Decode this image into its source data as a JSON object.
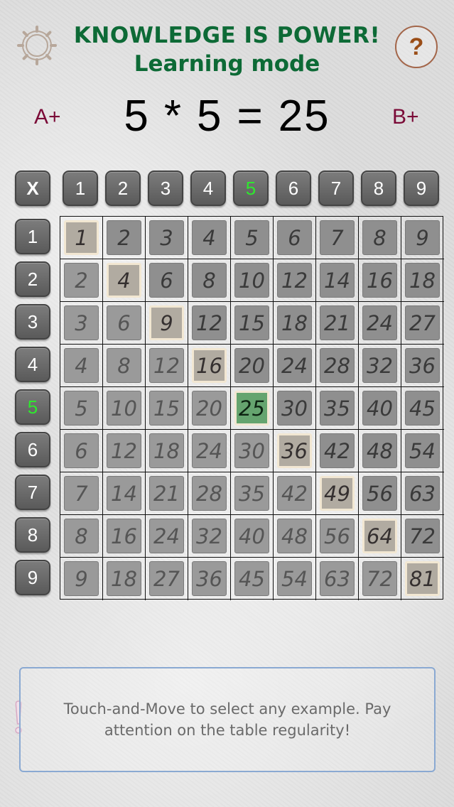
{
  "header": {
    "title": "KNOWLEDGE IS POWER!",
    "subtitle": "Learning mode",
    "settings_icon": "gear-icon",
    "help_label": "?"
  },
  "equation": {
    "a": "5",
    "op": "*",
    "b": "5",
    "eq": "=",
    "result": "25"
  },
  "grades": {
    "left": "A+",
    "right": "B+"
  },
  "corner_label": "X",
  "column_labels": [
    "1",
    "2",
    "3",
    "4",
    "5",
    "6",
    "7",
    "8",
    "9"
  ],
  "row_labels": [
    "1",
    "2",
    "3",
    "4",
    "5",
    "6",
    "7",
    "8",
    "9"
  ],
  "selected": {
    "row": 5,
    "col": 5
  },
  "colors": {
    "title": "#0d6a36",
    "grade": "#7a0a37",
    "active_label": "#2ee82e",
    "selected_cell": "#65a46f"
  },
  "table": [
    [
      "1",
      "2",
      "3",
      "4",
      "5",
      "6",
      "7",
      "8",
      "9"
    ],
    [
      "2",
      "4",
      "6",
      "8",
      "10",
      "12",
      "14",
      "16",
      "18"
    ],
    [
      "3",
      "6",
      "9",
      "12",
      "15",
      "18",
      "21",
      "24",
      "27"
    ],
    [
      "4",
      "8",
      "12",
      "16",
      "20",
      "24",
      "28",
      "32",
      "36"
    ],
    [
      "5",
      "10",
      "15",
      "20",
      "25",
      "30",
      "35",
      "40",
      "45"
    ],
    [
      "6",
      "12",
      "18",
      "24",
      "30",
      "36",
      "42",
      "48",
      "54"
    ],
    [
      "7",
      "14",
      "21",
      "28",
      "35",
      "42",
      "49",
      "56",
      "63"
    ],
    [
      "8",
      "16",
      "24",
      "32",
      "40",
      "48",
      "56",
      "64",
      "72"
    ],
    [
      "9",
      "18",
      "27",
      "36",
      "45",
      "54",
      "63",
      "72",
      "81"
    ]
  ],
  "hint": "Touch-and-Move to select any example. Pay attention on the table regularity!"
}
